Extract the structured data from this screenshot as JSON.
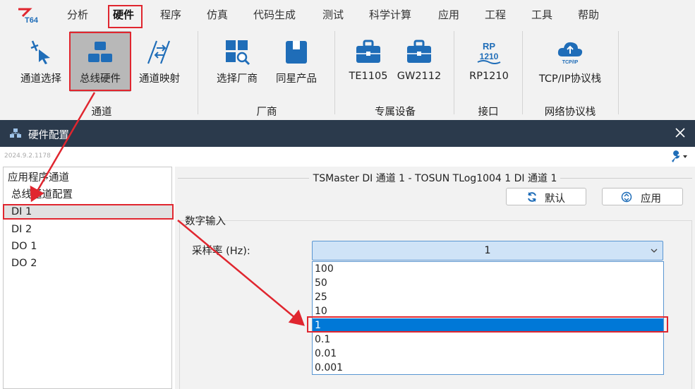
{
  "app": {
    "logo_text": "T64"
  },
  "menu": [
    {
      "label": "分析"
    },
    {
      "label": "硬件"
    },
    {
      "label": "程序"
    },
    {
      "label": "仿真"
    },
    {
      "label": "代码生成"
    },
    {
      "label": "测试"
    },
    {
      "label": "科学计算"
    },
    {
      "label": "应用"
    },
    {
      "label": "工程"
    },
    {
      "label": "工具"
    },
    {
      "label": "帮助"
    }
  ],
  "ribbon": {
    "buttons": [
      {
        "label": "通道选择",
        "icon": "cursor-pointer-icon"
      },
      {
        "label": "总线硬件",
        "icon": "hardware-blocks-icon"
      },
      {
        "label": "通道映射",
        "icon": "channel-mapping-icon"
      },
      {
        "label": "选择厂商",
        "icon": "vendor-search-icon"
      },
      {
        "label": "同星产品",
        "icon": "product-box-icon"
      },
      {
        "label": "TE1105",
        "icon": "toolbox-icon"
      },
      {
        "label": "GW2112",
        "icon": "toolbox-icon"
      },
      {
        "label": "RP1210",
        "icon": "rp1210-icon",
        "icon_text": "RP 1210"
      },
      {
        "label": "TCP/IP协议栈",
        "icon": "cloud-tcpip-icon",
        "icon_text": "TCP/IP"
      }
    ],
    "groups": [
      {
        "label": "通道"
      },
      {
        "label": "厂商"
      },
      {
        "label": "专属设备"
      },
      {
        "label": "接口"
      },
      {
        "label": "网络协议栈"
      }
    ]
  },
  "dialog": {
    "title": "硬件配置",
    "version": "2024.9.2.1178",
    "tree": [
      {
        "label": "应用程序通道"
      },
      {
        "label": "总线通道配置"
      },
      {
        "label": "DI 1"
      },
      {
        "label": "DI 2"
      },
      {
        "label": "DO 1"
      },
      {
        "label": "DO 2"
      }
    ],
    "panel_title": "TSMaster DI 通道 1 - TOSUN TLog1004 1 DI 通道 1",
    "default_button": "默认",
    "apply_button": "应用",
    "section_title": "数字输入",
    "rate_label": "采样率 (Hz):",
    "rate_value": "1",
    "rate_options": [
      "100",
      "50",
      "25",
      "10",
      "1",
      "0.1",
      "0.01",
      "0.001"
    ],
    "highlighted_option": "1"
  },
  "colors": {
    "dialog_title_bg": "#2b3a4c",
    "annotation_red": "#e0262f",
    "selection_blue": "#0078d7",
    "icon_blue": "#1f6db8"
  }
}
